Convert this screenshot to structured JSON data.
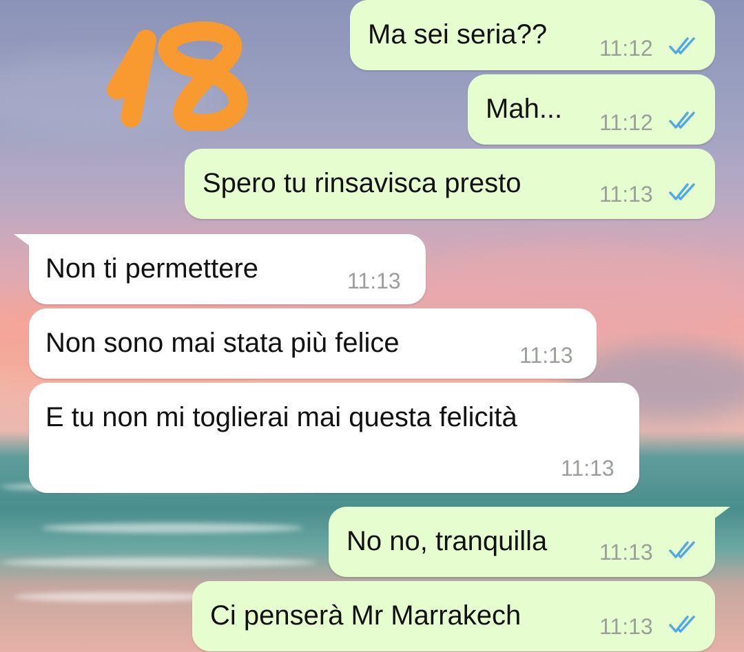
{
  "sticker": {
    "text": "18",
    "color": "#f99a30"
  },
  "messages": [
    {
      "text": "Ma sei seria??",
      "time": "11:12",
      "direction": "outgoing",
      "status": "read"
    },
    {
      "text": "Mah...",
      "time": "11:12",
      "direction": "outgoing",
      "status": "read"
    },
    {
      "text": "Spero tu rinsavisca presto",
      "time": "11:13",
      "direction": "outgoing",
      "status": "read"
    },
    {
      "text": "Non ti permettere",
      "time": "11:13",
      "direction": "incoming"
    },
    {
      "text": "Non sono mai stata più felice",
      "time": "11:13",
      "direction": "incoming"
    },
    {
      "text": "E tu non mi toglierai mai questa felicità",
      "time": "11:13",
      "direction": "incoming"
    },
    {
      "text": "No no, tranquilla",
      "time": "11:13",
      "direction": "outgoing",
      "status": "read"
    },
    {
      "text": "Ci penserà Mr Marrakech",
      "time": "11:13",
      "direction": "outgoing",
      "status": "read"
    }
  ],
  "colors": {
    "outgoing_bubble": "#e6fecf",
    "incoming_bubble": "#ffffff",
    "read_ticks": "#4fa9e6",
    "timestamp": "#9a9f9a"
  }
}
